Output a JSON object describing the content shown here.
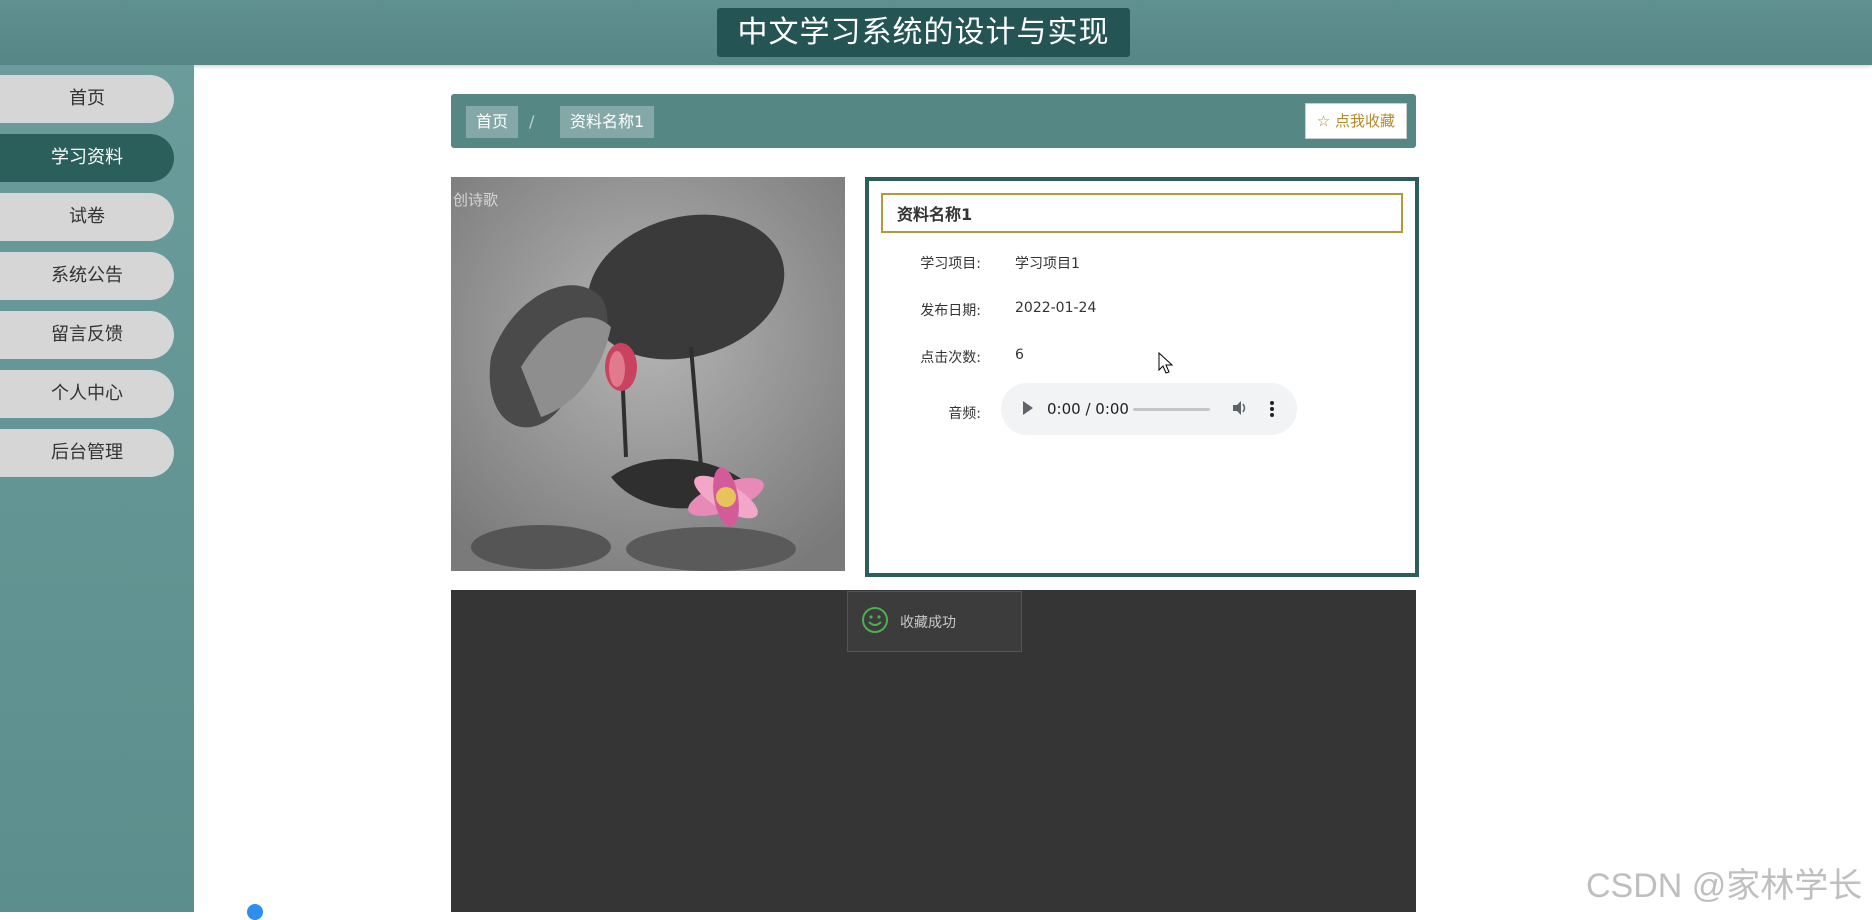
{
  "header": {
    "title": "中文学习系统的设计与实现"
  },
  "sidebar": {
    "items": [
      {
        "label": "首页",
        "active": false
      },
      {
        "label": "学习资料",
        "active": true
      },
      {
        "label": "试卷",
        "active": false
      },
      {
        "label": "系统公告",
        "active": false
      },
      {
        "label": "留言反馈",
        "active": false
      },
      {
        "label": "个人中心",
        "active": false
      },
      {
        "label": "后台管理",
        "active": false
      }
    ]
  },
  "breadcrumb": {
    "home": "首页",
    "separator": "/",
    "current": "资料名称1",
    "favorite_label": "☆ 点我收藏"
  },
  "cover": {
    "caption": "创诗歌"
  },
  "detail": {
    "title": "资料名称1",
    "rows": [
      {
        "label": "学习项目:",
        "value": "学习项目1"
      },
      {
        "label": "发布日期:",
        "value": "2022-01-24"
      },
      {
        "label": "点击次数:",
        "value": "6"
      }
    ],
    "audio_label": "音频:",
    "audio_time": "0:00 / 0:00"
  },
  "toast": {
    "text": "收藏成功"
  },
  "watermark": "CSDN @家林学长",
  "colors": {
    "primary": "#558785",
    "dark": "#2b5f5c",
    "gold": "#b38a2a"
  }
}
